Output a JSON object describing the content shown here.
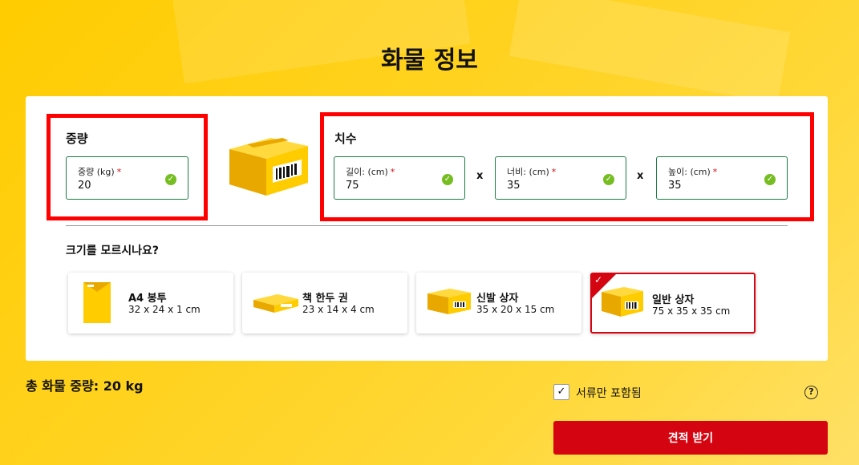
{
  "page_title": "화물 정보",
  "weight": {
    "section_label": "중량",
    "field_label": "중량 (kg)",
    "required_mark": "*",
    "value": "20"
  },
  "dimensions": {
    "section_label": "치수",
    "required_mark": "*",
    "times_symbol": "x",
    "length": {
      "label": "길이: (cm)",
      "value": "75"
    },
    "width": {
      "label": "너비: (cm)",
      "value": "35"
    },
    "height": {
      "label": "높이: (cm)",
      "value": "35"
    }
  },
  "unsure": {
    "title": "크기를 모르시나요?",
    "presets": [
      {
        "name": "A4 봉투",
        "size": "32 x 24 x 1 cm",
        "icon": "envelope-icon",
        "selected": false
      },
      {
        "name": "책 한두 권",
        "size": "23 x 14 x 4 cm",
        "icon": "flat-box-icon",
        "selected": false
      },
      {
        "name": "신발 상자",
        "size": "35 x 20 x 15 cm",
        "icon": "shoe-box-icon",
        "selected": false
      },
      {
        "name": "일반 상자",
        "size": "75 x 35 x 35 cm",
        "icon": "box-icon",
        "selected": true
      }
    ]
  },
  "total_weight": "총 화물 중량: 20 kg",
  "documents_only": {
    "label": "서류만 포함됨",
    "checked": true,
    "check_glyph": "✓"
  },
  "help_glyph": "?",
  "quote_button": "견적 받기",
  "colors": {
    "accent": "#d40511",
    "valid_green": "#76bd22",
    "background": "#ffcc00",
    "box_yellow": "#f2b900"
  }
}
